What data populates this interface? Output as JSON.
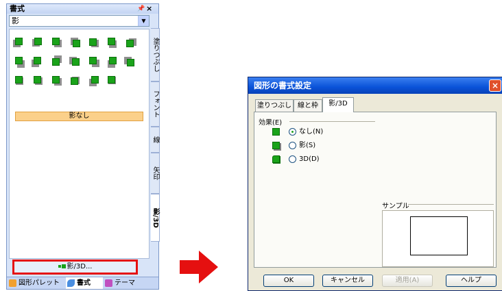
{
  "pane": {
    "title": "書式",
    "pin_icon": "pin-icon",
    "close_icon": "close-icon",
    "select_value": "影",
    "no_shadow_label": "影なし",
    "side_tabs": [
      "塗りつぶし",
      "フォント",
      "線",
      "矢印",
      "影/3D"
    ],
    "shadow_button_label": "影/3D...",
    "bottom_tabs": [
      "図形パレット",
      "書式",
      "テーマ"
    ]
  },
  "dialog": {
    "title": "図形の書式設定",
    "tabs": [
      "塗りつぶし",
      "線と枠",
      "影/3D"
    ],
    "effect_label": "効果(E)",
    "options": [
      {
        "label": "なし(N)",
        "selected": true
      },
      {
        "label": "影(S)",
        "selected": false
      },
      {
        "label": "3D(D)",
        "selected": false
      }
    ],
    "sample_label": "サンプル",
    "buttons": {
      "ok": "OK",
      "cancel": "キャンセル",
      "apply": "適用(A)",
      "help": "ヘルプ"
    }
  },
  "colors": {
    "accent_red": "#e51010",
    "shape_green": "#1aa31a",
    "title_blue": "#0a52d8"
  }
}
